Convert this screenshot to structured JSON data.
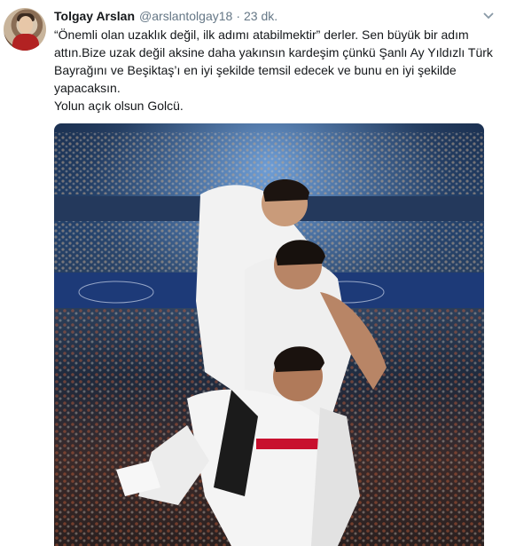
{
  "tweet": {
    "author_name": "Tolgay Arslan",
    "author_handle": "@arslantolgay18",
    "separator": "·",
    "timestamp": "23 dk.",
    "lines": [
      "“Önemli olan uzaklık değil, ilk adımı atabilmektir” derler. Sen büyük bir adım",
      "attın.Bize uzak değil aksine daha yakınsın kardeşim çünkü Şanlı Ay Yıldızlı Türk",
      "Bayrağını ve Beşiktaş’ı en iyi şekilde temsil edecek ve bunu en iyi şekilde",
      "yapacaksın.",
      "Yolun açık olsun Golcü."
    ]
  },
  "icons": {
    "avatar": "profile-photo",
    "menu": "chevron-down-icon"
  },
  "colors": {
    "name": "#14171a",
    "meta": "#657786",
    "kit_white": "#f2f2f2",
    "kit_black": "#1b1b1b",
    "stadium_blue": "#22406a"
  }
}
